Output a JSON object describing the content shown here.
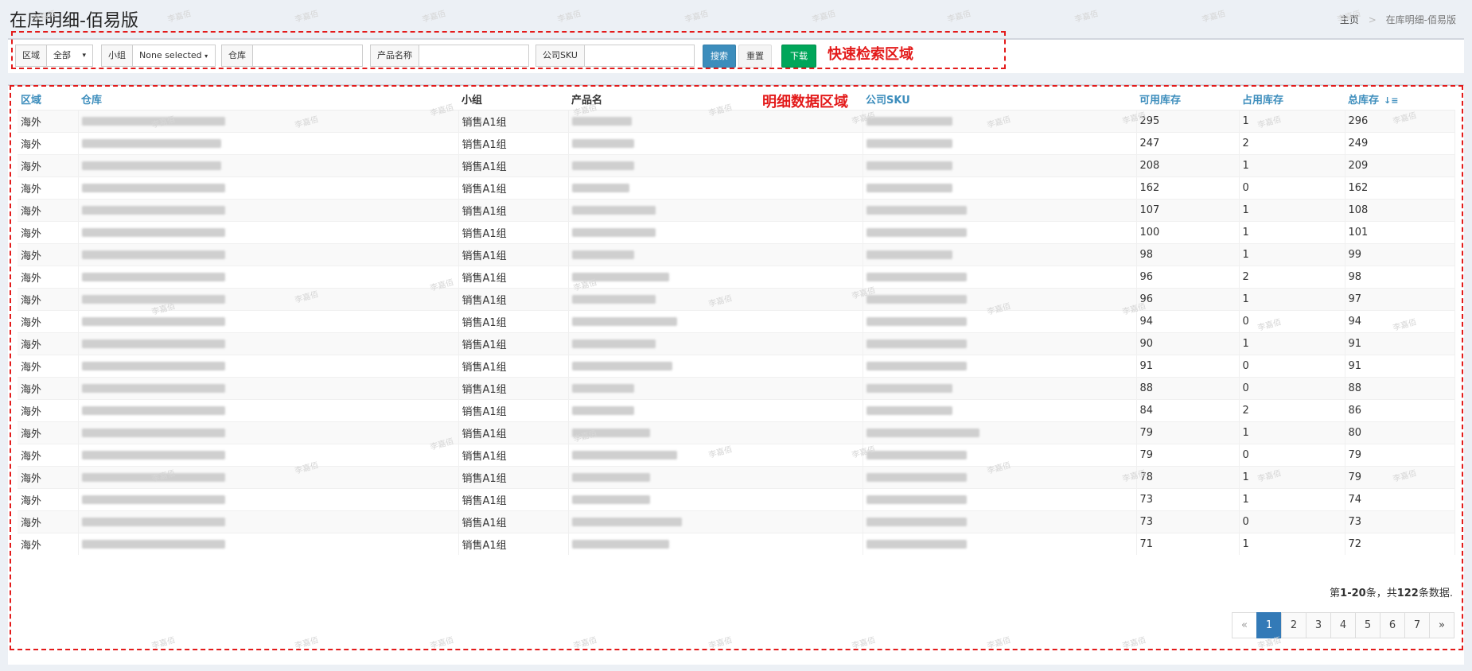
{
  "header": {
    "title": "在库明细-佰易版",
    "breadcrumb_home": "主页",
    "breadcrumb_sep": ">",
    "breadcrumb_current": "在库明细-佰易版"
  },
  "search": {
    "region_label": "区域",
    "region_value": "全部",
    "group_label": "小组",
    "group_value": "None selected",
    "warehouse_label": "仓库",
    "warehouse_value": "",
    "product_label": "产品名称",
    "product_value": "",
    "sku_label": "公司SKU",
    "sku_value": "",
    "search_button": "搜索",
    "reset_button": "重置",
    "download_button": "下载",
    "annotation": "快速检索区域"
  },
  "table": {
    "annotation": "明细数据区域",
    "headers": [
      "区域",
      "仓库",
      "小组",
      "产品名",
      "公司SKU",
      "可用库存",
      "占用库存",
      "总库存"
    ],
    "rows": [
      {
        "region": "海外",
        "group": "销售A1组",
        "available": "295",
        "occupied": "1",
        "total": "296"
      },
      {
        "region": "海外",
        "group": "销售A1组",
        "available": "247",
        "occupied": "2",
        "total": "249"
      },
      {
        "region": "海外",
        "group": "销售A1组",
        "available": "208",
        "occupied": "1",
        "total": "209"
      },
      {
        "region": "海外",
        "group": "销售A1组",
        "available": "162",
        "occupied": "0",
        "total": "162"
      },
      {
        "region": "海外",
        "group": "销售A1组",
        "available": "107",
        "occupied": "1",
        "total": "108"
      },
      {
        "region": "海外",
        "group": "销售A1组",
        "available": "100",
        "occupied": "1",
        "total": "101"
      },
      {
        "region": "海外",
        "group": "销售A1组",
        "available": "98",
        "occupied": "1",
        "total": "99"
      },
      {
        "region": "海外",
        "group": "销售A1组",
        "available": "96",
        "occupied": "2",
        "total": "98"
      },
      {
        "region": "海外",
        "group": "销售A1组",
        "available": "96",
        "occupied": "1",
        "total": "97"
      },
      {
        "region": "海外",
        "group": "销售A1组",
        "available": "94",
        "occupied": "0",
        "total": "94"
      },
      {
        "region": "海外",
        "group": "销售A1组",
        "available": "90",
        "occupied": "1",
        "total": "91"
      },
      {
        "region": "海外",
        "group": "销售A1组",
        "available": "91",
        "occupied": "0",
        "total": "91"
      },
      {
        "region": "海外",
        "group": "销售A1组",
        "available": "88",
        "occupied": "0",
        "total": "88"
      },
      {
        "region": "海外",
        "group": "销售A1组",
        "available": "84",
        "occupied": "2",
        "total": "86"
      },
      {
        "region": "海外",
        "group": "销售A1组",
        "available": "79",
        "occupied": "1",
        "total": "80"
      },
      {
        "region": "海外",
        "group": "销售A1组",
        "available": "79",
        "occupied": "0",
        "total": "79"
      },
      {
        "region": "海外",
        "group": "销售A1组",
        "available": "78",
        "occupied": "1",
        "total": "79"
      },
      {
        "region": "海外",
        "group": "销售A1组",
        "available": "73",
        "occupied": "1",
        "total": "74"
      },
      {
        "region": "海外",
        "group": "销售A1组",
        "available": "73",
        "occupied": "0",
        "total": "73"
      },
      {
        "region": "海外",
        "group": "销售A1组",
        "available": "71",
        "occupied": "1",
        "total": "72"
      }
    ]
  },
  "summary": {
    "prefix": "第",
    "range": "1-20",
    "mid": "条，共",
    "total": "122",
    "suffix": "条数据."
  },
  "pagination": {
    "prev": "«",
    "pages": [
      "1",
      "2",
      "3",
      "4",
      "5",
      "6",
      "7"
    ],
    "next": "»"
  },
  "watermark_text": "李嘉佰"
}
